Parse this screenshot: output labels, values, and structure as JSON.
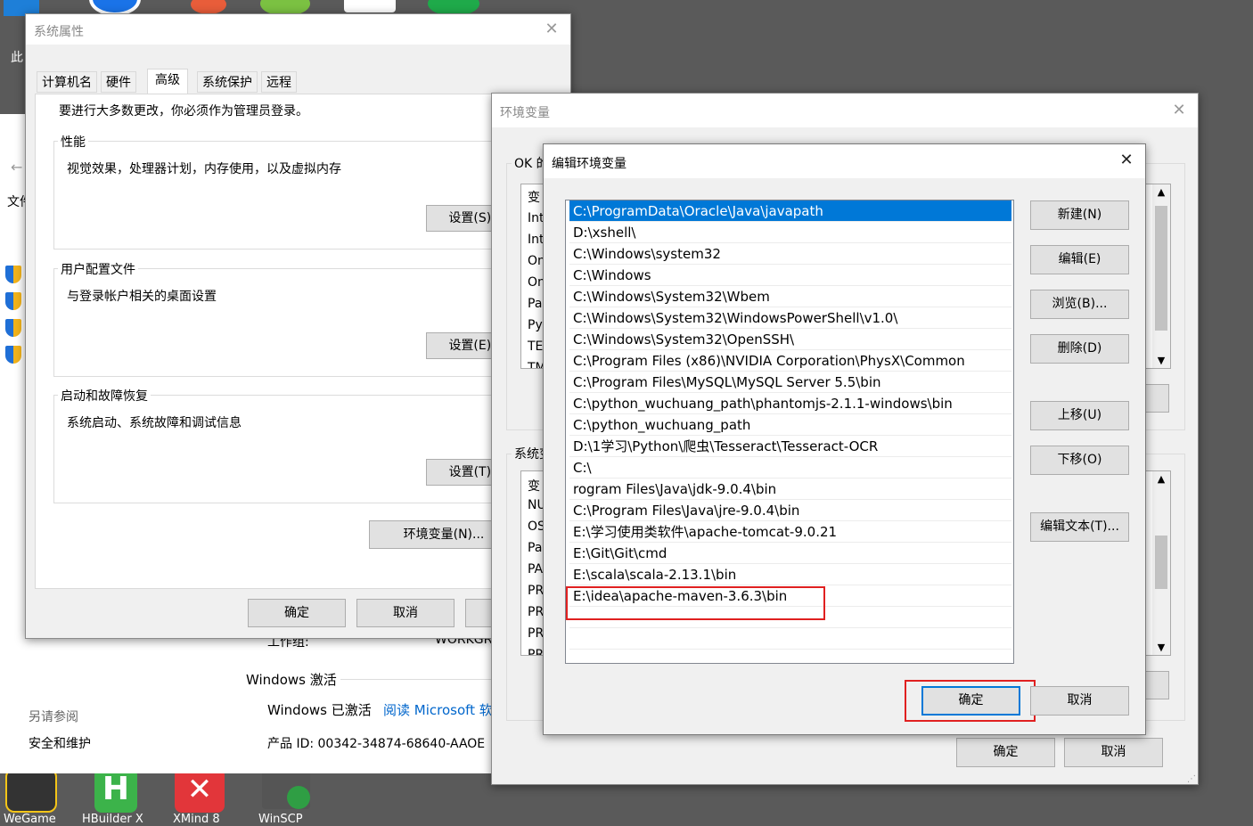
{
  "desktop": {
    "left_partial_label": "此",
    "left_partial_file": "文件",
    "bottom_icons": [
      {
        "name": "wegame",
        "label": "WeGame",
        "color": "#333333"
      },
      {
        "name": "hbuilder",
        "label": "HBuilder X",
        "color": "#3cb34a"
      },
      {
        "name": "xmind",
        "label": "XMind 8",
        "color": "#e2363a"
      },
      {
        "name": "winscp",
        "label": "WinSCP",
        "color": "#2f9e44"
      }
    ]
  },
  "underlay": {
    "workgroup_label": "工作组:",
    "workgroup_value": "WORKGR",
    "activation_header": "Windows 激活",
    "activated_text": "Windows 已激活",
    "read_link": "阅读 Microsoft 软",
    "see_also": "另请参阅",
    "security_link": "安全和维护",
    "product_id": "产品 ID: 00342-34874-68640-AAOE"
  },
  "sysprops": {
    "title": "系统属性",
    "tabs": [
      "计算机名",
      "硬件",
      "高级",
      "系统保护",
      "远程"
    ],
    "active_tab": "高级",
    "admin_note": "要进行大多数更改，你必须作为管理员登录。",
    "perf": {
      "legend": "性能",
      "desc": "视觉效果，处理器计划，内存使用，以及虚拟内存",
      "button": "设置(S)..."
    },
    "profile": {
      "legend": "用户配置文件",
      "desc": "与登录帐户相关的桌面设置",
      "button": "设置(E)..."
    },
    "startup": {
      "legend": "启动和故障恢复",
      "desc": "系统启动、系统故障和调试信息",
      "button": "设置(T)..."
    },
    "env_button": "环境变量(N)...",
    "ok": "确定",
    "cancel": "取消",
    "apply": "应"
  },
  "envvars": {
    "title": "环境变量",
    "user_group_prefix": "OK 的",
    "user_col_partial": "变",
    "user_rows_partial": [
      "Int",
      "Int",
      "On",
      "On",
      "Pa",
      "Py",
      "TE",
      "TM"
    ],
    "system_group_prefix": "系统变",
    "system_col_partial": "变",
    "system_rows_partial": [
      "NU",
      "OS",
      "Pa",
      "PA",
      "PR",
      "PR",
      "PR",
      "PR"
    ],
    "ok": "确定",
    "cancel": "取消"
  },
  "edit": {
    "title": "编辑环境变量",
    "items": [
      "C:\\ProgramData\\Oracle\\Java\\javapath",
      "D:\\xshell\\",
      "C:\\Windows\\system32",
      "C:\\Windows",
      "C:\\Windows\\System32\\Wbem",
      "C:\\Windows\\System32\\WindowsPowerShell\\v1.0\\",
      "C:\\Windows\\System32\\OpenSSH\\",
      "C:\\Program Files (x86)\\NVIDIA Corporation\\PhysX\\Common",
      "C:\\Program Files\\MySQL\\MySQL Server 5.5\\bin",
      "C:\\python_wuchuang_path\\phantomjs-2.1.1-windows\\bin",
      "C:\\python_wuchuang_path",
      "D:\\1学习\\Python\\爬虫\\Tesseract\\Tesseract-OCR",
      "C:\\",
      "rogram Files\\Java\\jdk-9.0.4\\bin",
      "C:\\Program Files\\Java\\jre-9.0.4\\bin",
      "E:\\学习使用类软件\\apache-tomcat-9.0.21",
      "E:\\Git\\Git\\cmd",
      "E:\\scala\\scala-2.13.1\\bin",
      "E:\\idea\\apache-maven-3.6.3\\bin"
    ],
    "selected_index": 0,
    "buttons": {
      "new": "新建(N)",
      "edit": "编辑(E)",
      "browse": "浏览(B)...",
      "delete": "删除(D)",
      "up": "上移(U)",
      "down": "下移(O)",
      "edit_text": "编辑文本(T)..."
    },
    "ok": "确定",
    "cancel": "取消",
    "highlight_color": "#e02020"
  }
}
